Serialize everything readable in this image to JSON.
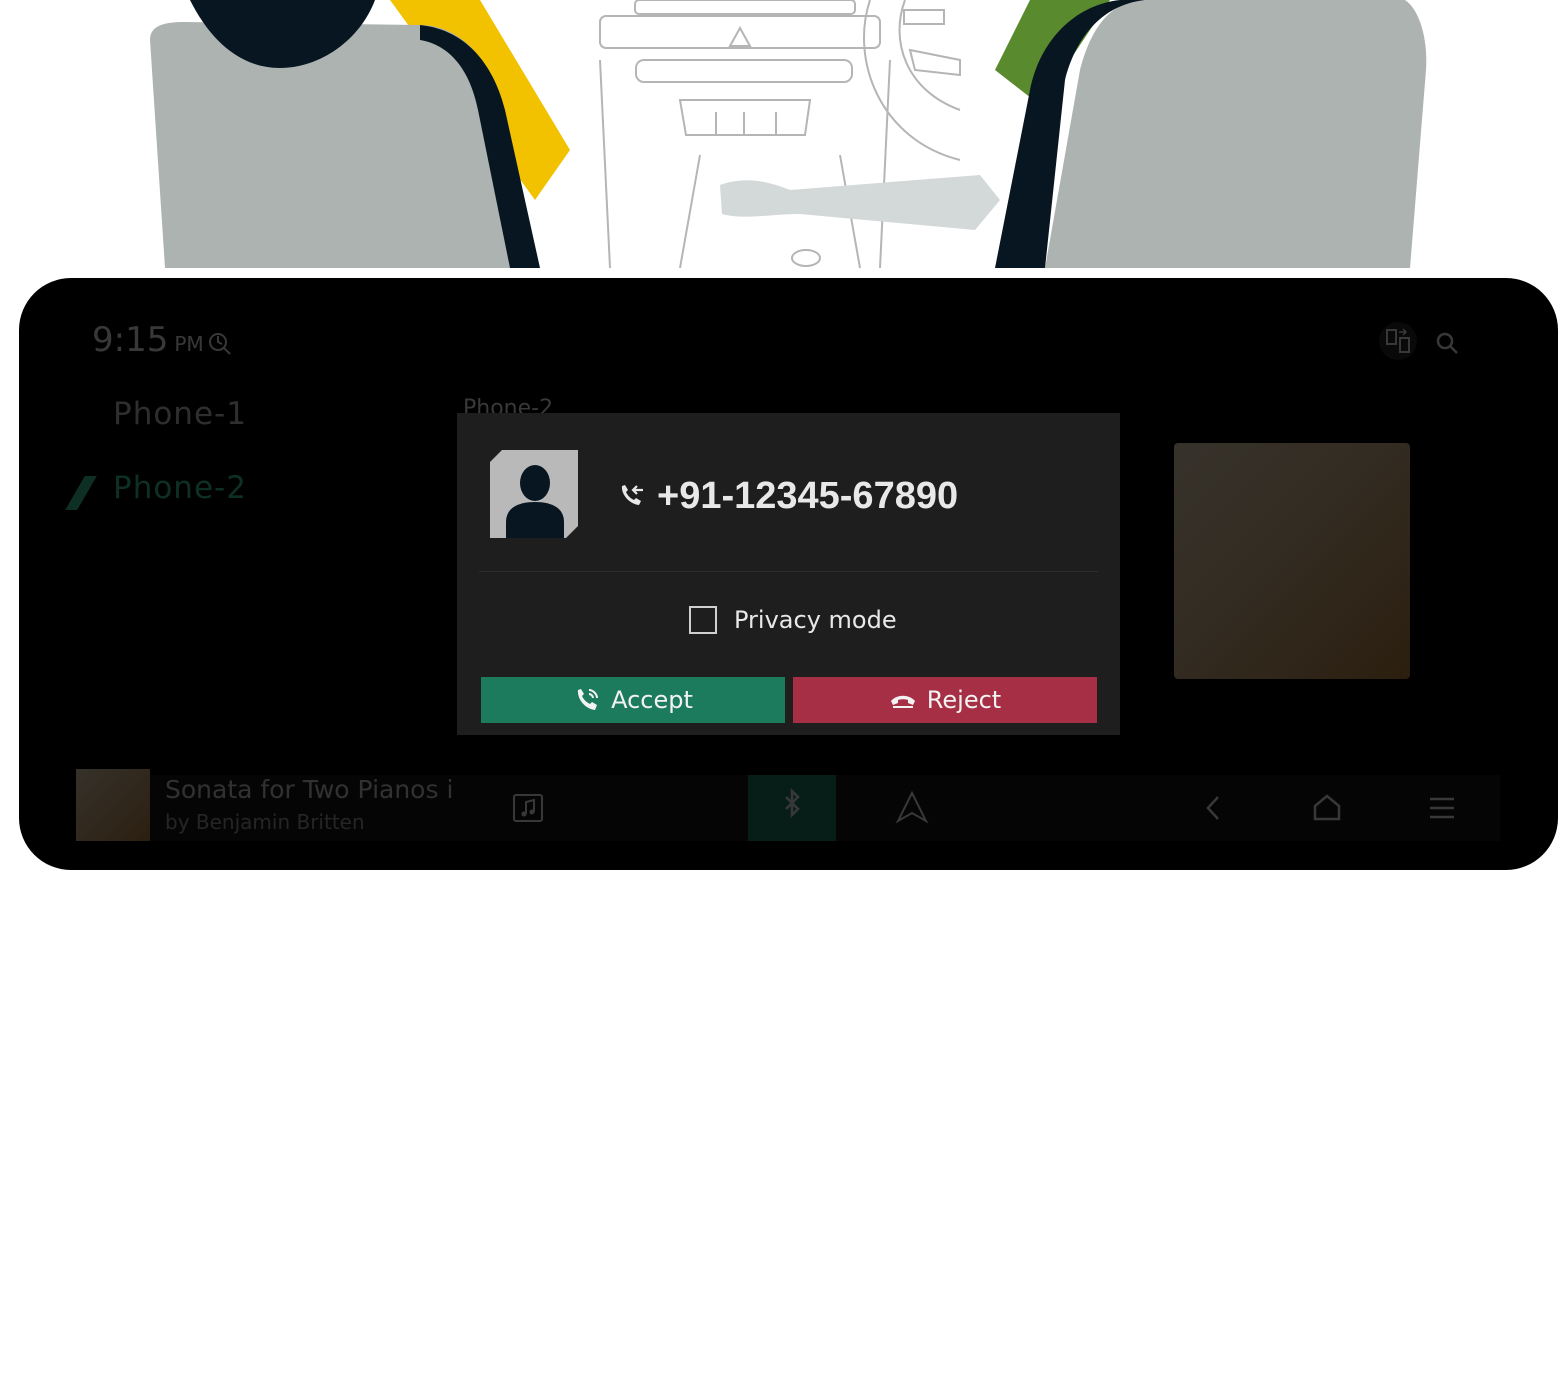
{
  "status": {
    "time": "9:15",
    "ampm": "PM"
  },
  "phones": {
    "items": [
      "Phone-1",
      "Phone-2"
    ],
    "active_index": 1
  },
  "background": {
    "heading": "Phone-2"
  },
  "now_playing": {
    "title": "Sonata for Two Pianos in",
    "artist": "by Benjamin Britten"
  },
  "dialog": {
    "caller_number": "+91-12345-67890",
    "privacy_label": "Privacy mode",
    "privacy_checked": false,
    "accept_label": "Accept",
    "reject_label": "Reject"
  },
  "colors": {
    "accept": "#1c7b5d",
    "reject": "#a62f46",
    "accent": "#3fd6a6",
    "dialog_bg": "#1e1e1e"
  },
  "icons": [
    "call-incoming-icon",
    "contact-avatar-icon",
    "accept-call-icon",
    "reject-call-icon",
    "search-icon",
    "phone-switch-icon",
    "music-icon",
    "bluetooth-music-icon",
    "android-auto-icon",
    "back-icon",
    "home-icon",
    "menu-icon"
  ]
}
